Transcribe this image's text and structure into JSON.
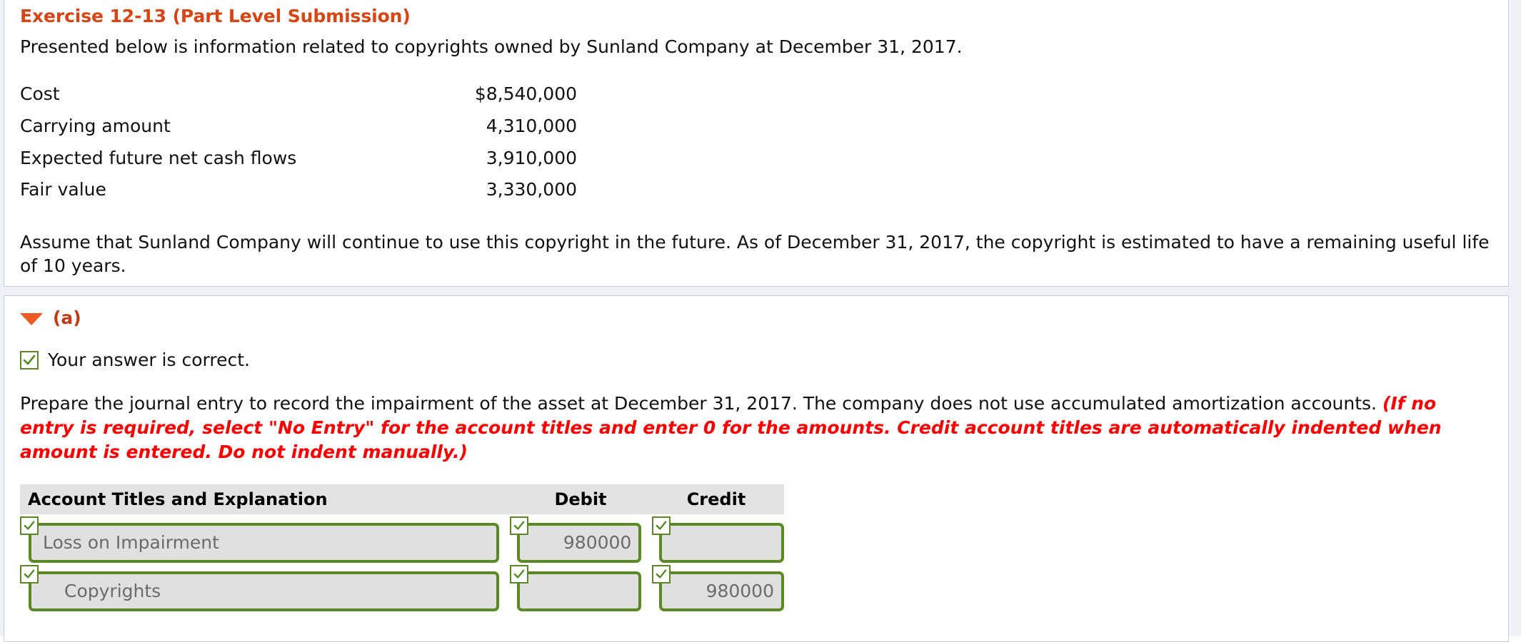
{
  "exercise": {
    "title": "Exercise 12-13 (Part Level Submission)",
    "intro": "Presented below is information related to copyrights owned by Sunland Company at December 31, 2017.",
    "facts": [
      {
        "label": "Cost",
        "value": "$8,540,000"
      },
      {
        "label": "Carrying amount",
        "value": "4,310,000"
      },
      {
        "label": "Expected future net cash flows",
        "value": "3,910,000"
      },
      {
        "label": "Fair value",
        "value": "3,330,000"
      }
    ],
    "assume": "Assume that Sunland Company will continue to use this copyright in the future. As of December 31, 2017, the copyright is estimated to have a remaining useful life of 10 years."
  },
  "part": {
    "expand_icon": "triangle-down-icon",
    "label": "(a)",
    "status_icon": "check-icon",
    "status_text": "Your answer is correct.",
    "prompt_plain": "Prepare the journal entry to record the impairment of the asset at December 31, 2017. The company does not use accumulated amortization accounts. ",
    "prompt_hint": "(If no entry is required, select \"No Entry\" for the account titles and enter 0 for the amounts. Credit account titles are automatically indented when amount is entered. Do not indent manually.)"
  },
  "journal": {
    "headers": {
      "account": "Account Titles and Explanation",
      "debit": "Debit",
      "credit": "Credit"
    },
    "rows": [
      {
        "account": "Loss on Impairment",
        "account_indent": false,
        "account_checked": true,
        "debit": "980000",
        "debit_checked": true,
        "credit": "",
        "credit_checked": true
      },
      {
        "account": "Copyrights",
        "account_indent": true,
        "account_checked": true,
        "debit": "",
        "debit_checked": true,
        "credit": "980000",
        "credit_checked": true
      }
    ]
  },
  "colors": {
    "title_orange": "#d94413",
    "hint_red": "#ff0000",
    "correct_green": "#5c8727",
    "field_border_green": "#5a8a22",
    "header_gray": "#e3e3e3",
    "panel_border": "#c5d0dd"
  }
}
